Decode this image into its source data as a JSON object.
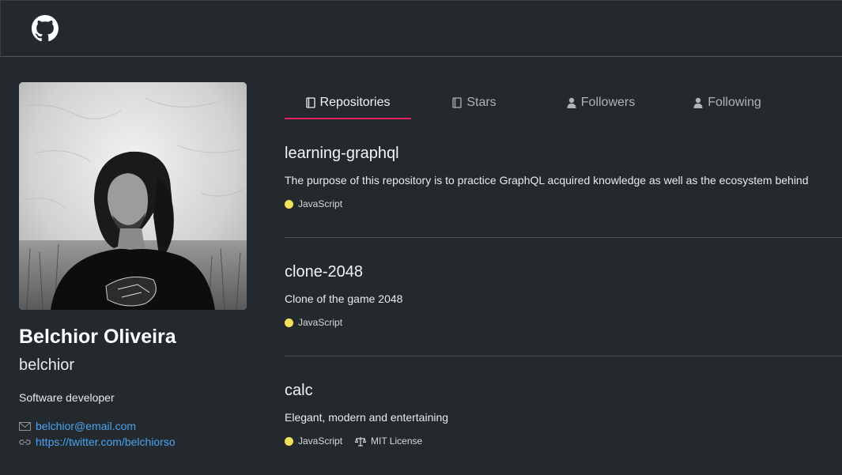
{
  "header": {
    "logo_icon": "github-octocat-icon"
  },
  "profile": {
    "name": "Belchior Oliveira",
    "login": "belchior",
    "bio": "Software developer",
    "email": "belchior@email.com",
    "twitter": "https://twitter.com/belchiorso"
  },
  "tabs": [
    {
      "label": "Repositories",
      "icon": "book-icon",
      "active": true
    },
    {
      "label": "Stars",
      "icon": "book-icon",
      "active": false
    },
    {
      "label": "Followers",
      "icon": "person-icon",
      "active": false
    },
    {
      "label": "Following",
      "icon": "person-icon",
      "active": false
    }
  ],
  "repositories": [
    {
      "name": "learning-graphql",
      "description": "The purpose of this repository is to practice GraphQL acquired knowledge as well as the ecosystem behind",
      "language": "JavaScript",
      "language_color": "#f1e05a"
    },
    {
      "name": "clone-2048",
      "description": "Clone of the game 2048",
      "language": "JavaScript",
      "language_color": "#f1e05a"
    },
    {
      "name": "calc",
      "description": "Elegant, modern and entertaining",
      "language": "JavaScript",
      "language_color": "#f1e05a",
      "license": "MIT License"
    }
  ],
  "colors": {
    "background": "#24292e",
    "accent": "#e5245e",
    "link": "#4aa3f0"
  }
}
